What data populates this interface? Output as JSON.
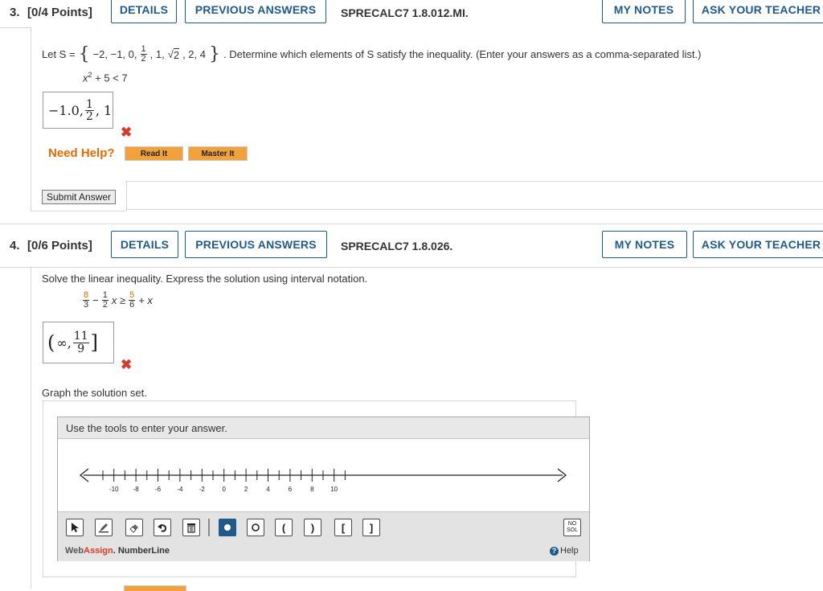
{
  "q3": {
    "number": "3.",
    "points": "[0/4 Points]",
    "details_label": "DETAILS",
    "previous_answers_label": "PREVIOUS ANSWERS",
    "code": "SPRECALC7 1.8.012.MI.",
    "my_notes_label": "MY NOTES",
    "ask_teacher_label": "ASK YOUR TEACHER",
    "prompt_prefix": "Let S =",
    "set_open": "{",
    "set_items_a": "−2, −1, 0,",
    "half_num": "1",
    "half_den": "2",
    "set_items_b": ", 1,",
    "sqrt_sym": "√",
    "sqrt_arg": "2",
    "set_items_c": ", 2, 4",
    "set_close": "}",
    "prompt_suffix": ". Determine which elements of S satisfy the inequality. (Enter your answers as a comma-separated list.)",
    "inequality_x": "x",
    "inequality_exp": "2",
    "inequality_rest": "+ 5 < 7",
    "answer_a": "−1.0,",
    "answer_frac_num": "1",
    "answer_frac_den": "2",
    "answer_b": ", 1",
    "wrong_mark": "✖",
    "need_help": "Need Help?",
    "read_it": "Read It",
    "master_it": "Master It",
    "submit_answer": "Submit Answer"
  },
  "q4": {
    "number": "4.",
    "points": "[0/6 Points]",
    "details_label": "DETAILS",
    "previous_answers_label": "PREVIOUS ANSWERS",
    "code": "SPRECALC7 1.8.026.",
    "my_notes_label": "MY NOTES",
    "ask_teacher_label": "ASK YOUR TEACHER",
    "prompt": "Solve the linear inequality. Express the solution using interval notation.",
    "ineq_f1_num": "8",
    "ineq_f1_den": "3",
    "ineq_minus": "−",
    "ineq_f2_num": "1",
    "ineq_f2_den": "2",
    "ineq_x_geq": "x ≥",
    "ineq_f3_num": "5",
    "ineq_f3_den": "6",
    "ineq_plus_x": "+ x",
    "answer_open": "(",
    "answer_inf": "∞,",
    "answer_frac_num": "11",
    "answer_frac_den": "9",
    "answer_close": "]",
    "wrong_mark": "✖",
    "graph_prompt": "Graph the solution set.",
    "tool_instruction": "Use the tools to enter your answer.",
    "tick_labels": [
      "-10",
      "-8",
      "-6",
      "-4",
      "-2",
      "0",
      "2",
      "4",
      "6",
      "8",
      "10"
    ],
    "tools": [
      "pointer-icon",
      "pencil-icon",
      "eraser-icon",
      "undo-icon",
      "trash-icon",
      "filled-point-icon",
      "open-point-icon",
      "open-paren-icon",
      "close-paren-icon",
      "open-bracket-icon",
      "close-bracket-icon"
    ],
    "no_sol_line1": "NO",
    "no_sol_line2": "SOL",
    "brand_web": "Web",
    "brand_assign": "Assign",
    "brand_product": ". NumberLine",
    "help_icon": "?",
    "help_label": "Help"
  },
  "colors": {
    "accent_blue": "#1f5a8a",
    "need_help_orange": "#e26a00",
    "error_red": "#d9392b",
    "button_orange": "#f3a23b"
  }
}
